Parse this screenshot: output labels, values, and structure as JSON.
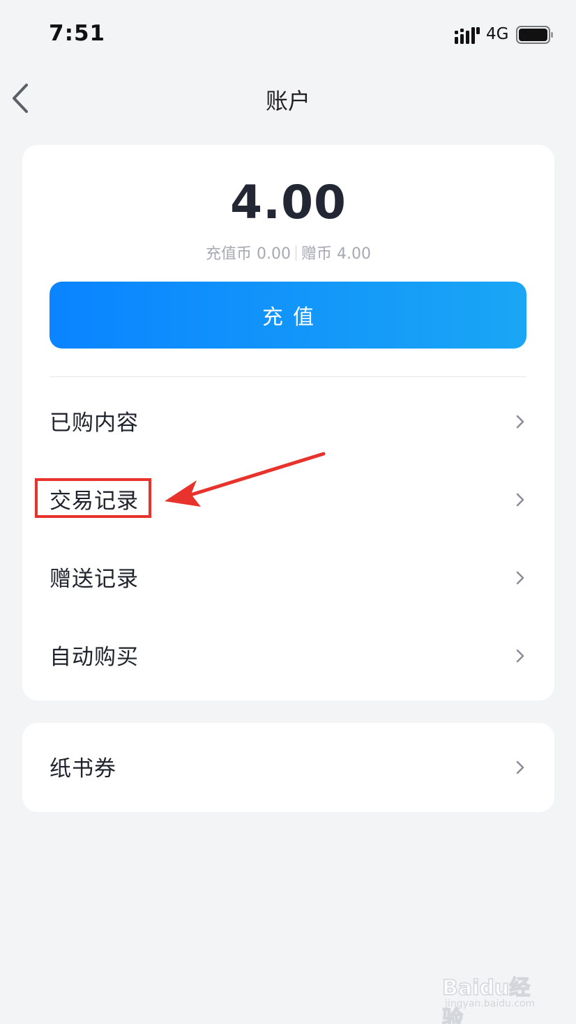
{
  "status_bar": {
    "time": "7:51",
    "network": "4G"
  },
  "nav": {
    "title": "账户"
  },
  "account": {
    "balance": "4.00",
    "recharge_coins": "充值币 0.00",
    "gift_coins": "赠币 4.00",
    "recharge_label": "充值",
    "menu": [
      {
        "label": "已购内容"
      },
      {
        "label": "交易记录"
      },
      {
        "label": "赠送记录"
      },
      {
        "label": "自动购买"
      }
    ]
  },
  "voucher": {
    "label": "纸书券"
  },
  "watermark": {
    "brand": "Baidu经验",
    "url": "jingyan.baidu.com"
  },
  "colors": {
    "accent": "#0a84ff",
    "annotation": "#e8322c",
    "background": "#f3f4f6"
  }
}
